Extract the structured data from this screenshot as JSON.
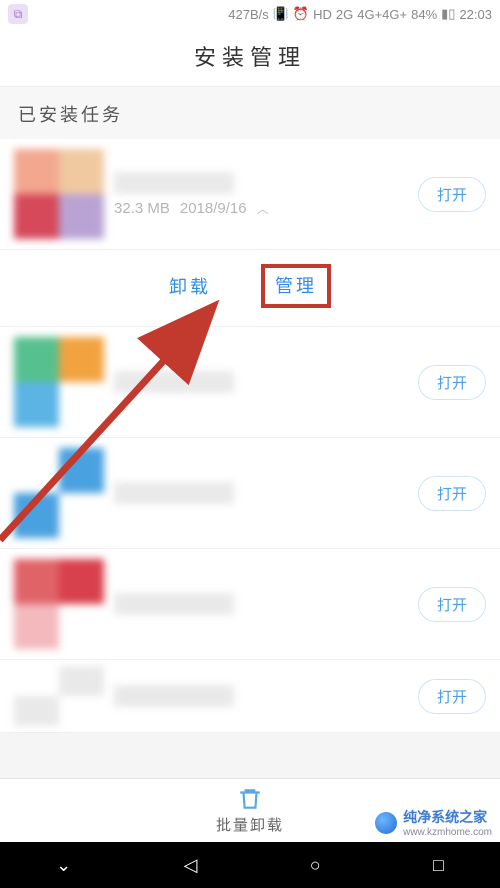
{
  "status": {
    "dataRate": "427B/s",
    "netBadge": "HD",
    "net2g": "2G",
    "net4g": "4G+4G+",
    "battery": "84%",
    "time": "22:03"
  },
  "header": {
    "title": "安装管理"
  },
  "section": {
    "installed_label": "已安装任务"
  },
  "apps": [
    {
      "size": "32.3 MB",
      "date": "2018/9/16",
      "open": "打开",
      "uninstall": "卸载",
      "manage": "管理",
      "iconColors": [
        "#f3a78f",
        "#f0c9a0",
        "#d6495a",
        "#b9a3d4"
      ]
    },
    {
      "open": "打开",
      "iconColors": [
        "#57c08f",
        "#f2a340",
        "#5bb4e4",
        "#ffffff"
      ]
    },
    {
      "open": "打开",
      "iconColors": [
        "#ffffff",
        "#4aa1df",
        "#4aa1df",
        "#ffffff"
      ]
    },
    {
      "open": "打开",
      "iconColors": [
        "#e06368",
        "#d8404d",
        "#f3b9bd",
        "#ffffff"
      ]
    },
    {
      "open": "打开",
      "iconColors": [
        "#ffffff",
        "#e9e9e9",
        "#e9e9e9",
        "#ffffff"
      ]
    }
  ],
  "bottom": {
    "batch_uninstall": "批量卸载"
  },
  "watermark": {
    "text": "纯净系统之家",
    "url": "www.kzmhome.com"
  }
}
